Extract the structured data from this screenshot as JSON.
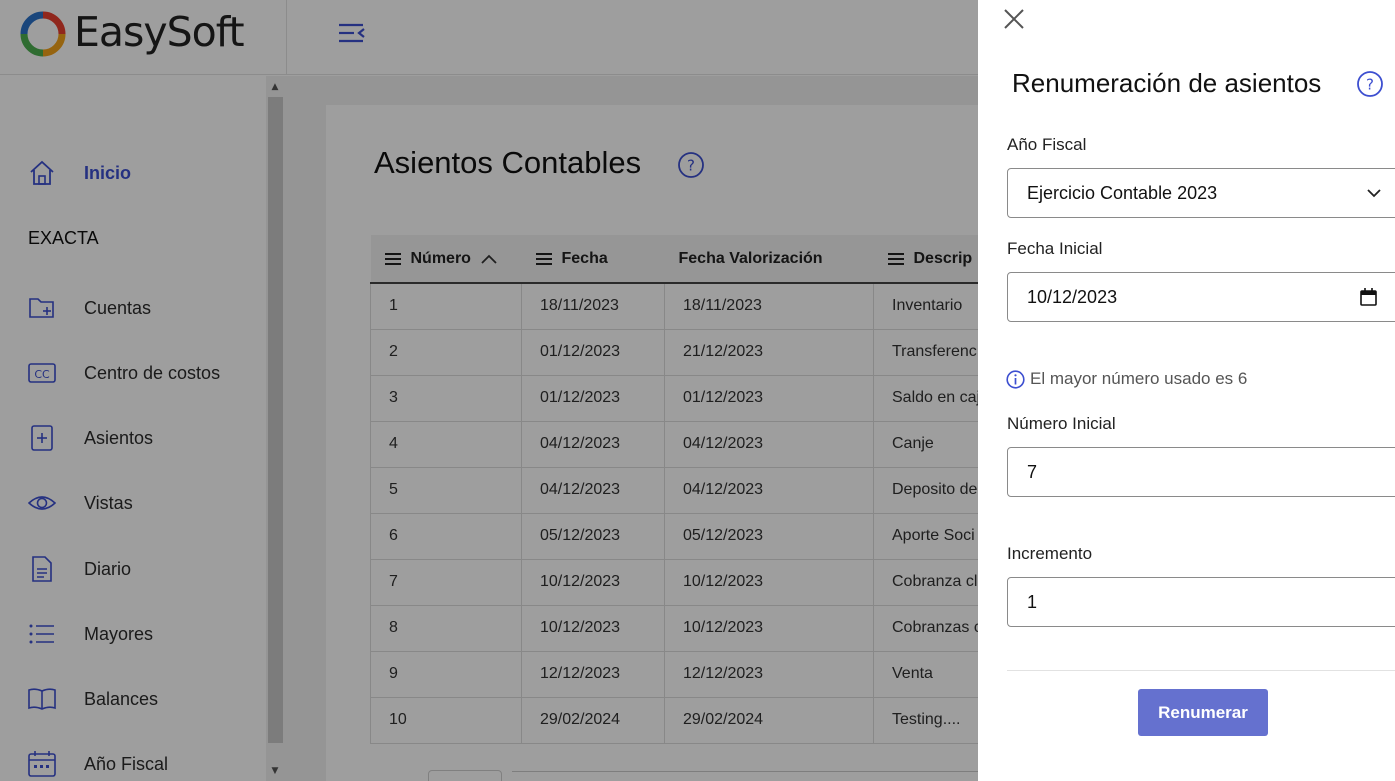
{
  "app": {
    "logo_text": "EasySoft"
  },
  "sidebar": {
    "section_label": "EXACTA",
    "items": [
      {
        "label": "Inicio",
        "icon": "home-icon",
        "active": true
      },
      {
        "label": "Cuentas",
        "icon": "folder-add-icon"
      },
      {
        "label": "Centro de costos",
        "icon": "cc-icon"
      },
      {
        "label": "Asientos",
        "icon": "document-plus-icon"
      },
      {
        "label": "Vistas",
        "icon": "eye-icon"
      },
      {
        "label": "Diario",
        "icon": "document-lines-icon"
      },
      {
        "label": "Mayores",
        "icon": "list-icon"
      },
      {
        "label": "Balances",
        "icon": "book-icon"
      },
      {
        "label": "Año Fiscal",
        "icon": "calendar-icon"
      }
    ]
  },
  "main": {
    "title": "Asientos Contables",
    "table": {
      "headers": [
        "Número",
        "Fecha",
        "Fecha Valorización",
        "Descrip"
      ],
      "rows": [
        [
          "1",
          "18/11/2023",
          "18/11/2023",
          "Inventario"
        ],
        [
          "2",
          "01/12/2023",
          "21/12/2023",
          "Transferenc"
        ],
        [
          "3",
          "01/12/2023",
          "01/12/2023",
          "Saldo en caj"
        ],
        [
          "4",
          "04/12/2023",
          "04/12/2023",
          "Canje"
        ],
        [
          "5",
          "04/12/2023",
          "04/12/2023",
          "Deposito de"
        ],
        [
          "6",
          "05/12/2023",
          "05/12/2023",
          "Aporte Soci"
        ],
        [
          "7",
          "10/12/2023",
          "10/12/2023",
          "Cobranza cl"
        ],
        [
          "8",
          "10/12/2023",
          "10/12/2023",
          "Cobranzas c"
        ],
        [
          "9",
          "12/12/2023",
          "12/12/2023",
          "Venta"
        ],
        [
          "10",
          "29/02/2024",
          "29/02/2024",
          "Testing...."
        ]
      ]
    }
  },
  "drawer": {
    "title": "Renumeración de asientos",
    "fiscal_year_label": "Año Fiscal",
    "fiscal_year_value": "Ejercicio Contable 2023",
    "start_date_label": "Fecha Inicial",
    "start_date_value": "10/12/2023",
    "info_text": "El mayor número usado es 6",
    "start_number_label": "Número Inicial",
    "start_number_value": "7",
    "increment_label": "Incremento",
    "increment_value": "1",
    "submit_label": "Renumerar"
  },
  "colors": {
    "accent": "#3d4fd0",
    "button": "#6571cf"
  }
}
